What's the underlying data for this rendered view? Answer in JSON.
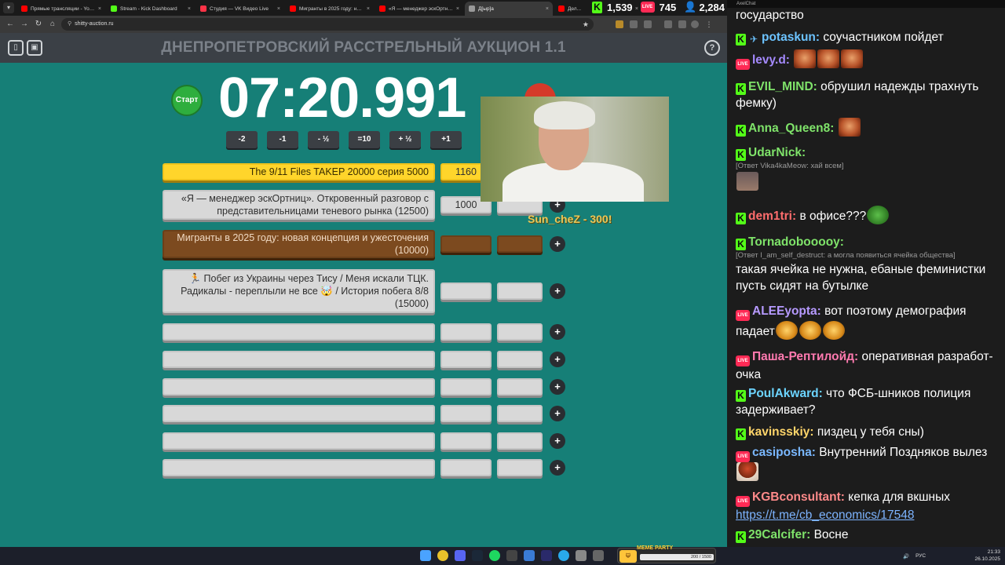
{
  "browser": {
    "tabs": [
      {
        "title": "Прямые трансляции - YouTube",
        "color": "#ff0000"
      },
      {
        "title": "Stream - Kick Dashboard",
        "color": "#53fc18"
      },
      {
        "title": "Студия — VK Видео Live",
        "color": "#ff3347"
      },
      {
        "title": "Мигранты в 2025 году: нова",
        "color": "#ff0000"
      },
      {
        "title": "«Я — менеджер эскОртниц",
        "color": "#ff0000"
      },
      {
        "title": "Д[ыр]а",
        "color": "#999999"
      },
      {
        "title": "Дел...",
        "color": "#ff0000"
      }
    ],
    "url": "shitty-auction.ru"
  },
  "page": {
    "title": "ДНЕПРОПЕТРОВСКИЙ РАССТРЕЛЬНЫЙ АУКЦИОН 1.1",
    "help_label": "?",
    "start_label": "Старт",
    "timer": "07:20.991",
    "adjust_buttons": [
      "-2",
      "-1",
      "- ½",
      "=10",
      "+ ½",
      "+1"
    ],
    "lots": [
      {
        "name": "The 9/11 Files TAKEP 20000 серия 5000",
        "amount": "1160",
        "style": "gold"
      },
      {
        "name": "«Я — менеджер эскОртниц». Откровенный разговор с представительницами теневого рынка (12500)",
        "amount": "1000",
        "style": "grey"
      },
      {
        "name": "Мигранты в 2025 году: новая концепция и ужесточения (10000)",
        "amount": "",
        "style": "brown"
      },
      {
        "name": "🏃 Побег из Украины через Тису / Меня искали ТЦК. Радикалы - переплыли не все 🤯 / История побега 8/8 (15000)",
        "amount": "",
        "style": "grey"
      },
      {
        "name": "",
        "amount": "",
        "style": "grey"
      },
      {
        "name": "",
        "amount": "",
        "style": "grey"
      },
      {
        "name": "",
        "amount": "",
        "style": "grey"
      },
      {
        "name": "",
        "amount": "",
        "style": "grey"
      },
      {
        "name": "",
        "amount": "",
        "style": "grey"
      },
      {
        "name": "",
        "amount": "",
        "style": "grey"
      }
    ],
    "plus_label": "+",
    "donor_text": "Sun_cheZ - 300!"
  },
  "viewers": {
    "kick": "1,539",
    "vk": "745",
    "youtube": "2,284"
  },
  "chat": {
    "app_title": "AxelChat",
    "messages": [
      {
        "platform": "none",
        "nick": "",
        "nick_color": "#ffffff",
        "text": "государство",
        "emotes": []
      },
      {
        "platform": "kick",
        "nick": "potaskun:",
        "nick_color": "#6cc3ff",
        "prefix_icon": "tg",
        "text": "соучастником пойдет",
        "emotes": []
      },
      {
        "platform": "live",
        "nick": "levy.d:",
        "nick_color": "#a58aff",
        "text": "",
        "emotes": [
          "face",
          "face",
          "face"
        ]
      },
      {
        "platform": "kick",
        "nick": "EVIL_MIND:",
        "nick_color": "#7fe36a",
        "text": "обрушил надежды трахнуть фемку)",
        "emotes": []
      },
      {
        "platform": "kick",
        "nick": "Anna_Queen8:",
        "nick_color": "#7fe36a",
        "text": "",
        "emotes": [
          "face"
        ]
      },
      {
        "platform": "kick",
        "nick": "UdarNick:",
        "nick_color": "#7fe36a",
        "reply": "[Ответ Vika4kaMeow: хай всем]",
        "text": "",
        "emotes": [
          "avatar"
        ]
      },
      {
        "platform": "kick",
        "nick": "dem1tri:",
        "nick_color": "#ff6d6d",
        "text": "в офисе???",
        "emotes": [
          "pepe"
        ]
      },
      {
        "platform": "kick",
        "nick": "Tornadobooooy:",
        "nick_color": "#7fe36a",
        "reply": "[Ответ I_am_self_destruct: а могла появиться ячейка общества]",
        "text": "такая ячейка не нужна, ебаные феминистки пусть сидят на бутылке",
        "emotes": []
      },
      {
        "platform": "live",
        "nick": "ALEEyopta:",
        "nick_color": "#b69aff",
        "text": "вот поэтому демография падает",
        "emotes": [
          "angry",
          "angry",
          "angry"
        ]
      },
      {
        "platform": "live",
        "nick": "Паша-Рептилойд:",
        "nick_color": "#ff7ab0",
        "text": "оперативная разработ-очка",
        "emotes": []
      },
      {
        "platform": "kick",
        "nick": "PoulAkward:",
        "nick_color": "#6cd4ff",
        "text": "что ФСБ-шников полиция задерживает?",
        "emotes": []
      },
      {
        "platform": "kick",
        "nick": "kavinsskiy:",
        "nick_color": "#ffd56a",
        "text": "пиздец у тебя сны)",
        "emotes": []
      },
      {
        "platform": "live",
        "nick": "casiposha:",
        "nick_color": "#7ab8ff",
        "text": "Внутренний Поздняков вылез",
        "emotes": [
          "mush"
        ]
      },
      {
        "platform": "live",
        "nick": "KGBconsultant:",
        "nick_color": "#ff8a8a",
        "text": "кепка для вкшных",
        "link": "https://t.me/cb_economics/17548",
        "emotes": []
      },
      {
        "platform": "kick",
        "nick": "29Calcifer:",
        "nick_color": "#7fe36a",
        "text": "Восне",
        "emotes": []
      }
    ]
  },
  "taskbar": {
    "meme_party_label": "MEME PARTY",
    "meme_party_progress": "200 / 1500",
    "lang": "РУС",
    "time": "21:33",
    "date": "26.10.2025"
  }
}
